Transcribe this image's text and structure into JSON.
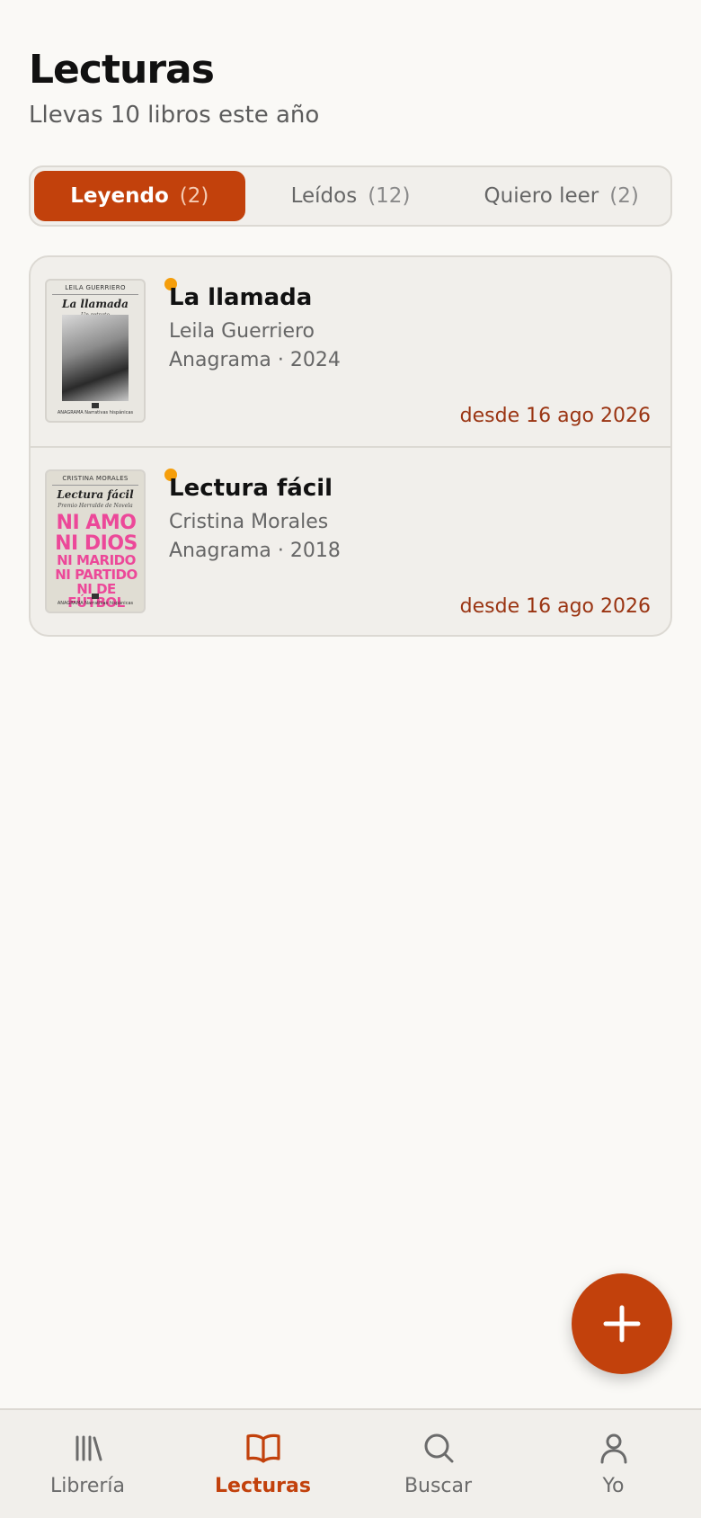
{
  "header": {
    "title": "Lecturas",
    "subtitle": "Llevas 10 libros este año"
  },
  "tabs": [
    {
      "label": "Leyendo",
      "count": "(2)",
      "active": true
    },
    {
      "label": "Leídos",
      "count": "(12)",
      "active": false
    },
    {
      "label": "Quiero leer",
      "count": "(2)",
      "active": false
    }
  ],
  "books": [
    {
      "title": "La llamada",
      "author": "Leila Guerriero",
      "meta": "Anagrama · 2024",
      "since": "desde 16 ago 2026",
      "cover": {
        "author": "LEILA GUERRIERO",
        "title": "La llamada",
        "subtitle": "Un retrato",
        "publisher": "ANAGRAMA Narrativas hispánicas"
      }
    },
    {
      "title": "Lectura fácil",
      "author": "Cristina Morales",
      "meta": "Anagrama · 2018",
      "since": "desde 16 ago 2026",
      "cover": {
        "author": "CRISTINA MORALES",
        "title": "Lectura fácil",
        "subtitle": "Premio Herralde de Novela",
        "line1": "NI AMO",
        "line2": "NI DIOS",
        "line3": "NI MARIDO",
        "line4": "NI PARTIDO",
        "line5": "NI DE FÚTBOL",
        "publisher": "ANAGRAMA Narrativas hispánicas"
      }
    }
  ],
  "nav": [
    {
      "label": "Librería",
      "icon": "library-icon",
      "active": false
    },
    {
      "label": "Lecturas",
      "icon": "open-book-icon",
      "active": true
    },
    {
      "label": "Buscar",
      "icon": "search-icon",
      "active": false
    },
    {
      "label": "Yo",
      "icon": "user-icon",
      "active": false
    }
  ],
  "colors": {
    "accent": "#c2410c",
    "reading_dot": "#f59e0b",
    "background": "#faf9f6",
    "card": "#f1efeb"
  }
}
